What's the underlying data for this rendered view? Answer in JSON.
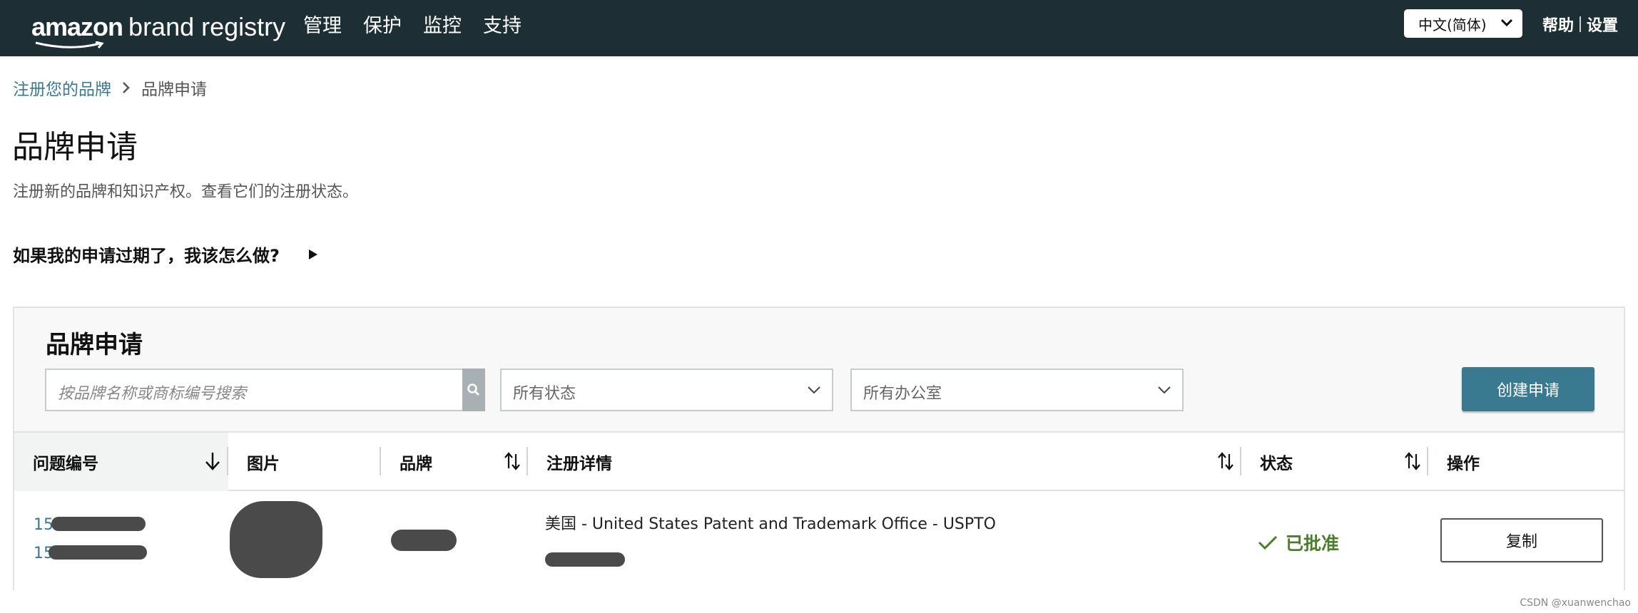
{
  "header": {
    "logo_amazon": "amazon",
    "logo_rest": "brand registry",
    "nav": [
      "管理",
      "保护",
      "监控",
      "支持"
    ],
    "language": "中文(简体)",
    "help": "帮助",
    "settings": "设置"
  },
  "breadcrumb": {
    "parent": "注册您的品牌",
    "current": "品牌申请"
  },
  "page": {
    "title": "品牌申请",
    "subtitle": "注册新的品牌和知识产权。查看它们的注册状态。",
    "faq": "如果我的申请过期了，我该怎么做?"
  },
  "panel": {
    "title": "品牌申请",
    "search_placeholder": "按品牌名称或商标编号搜索",
    "status_filter": "所有状态",
    "office_filter": "所有办公室",
    "create_button": "创建申请"
  },
  "table": {
    "columns": [
      "问题编号",
      "图片",
      "品牌",
      "注册详情",
      "状态",
      "操作"
    ],
    "rows": [
      {
        "id_1": "15",
        "id_2": "15",
        "registration": "美国 - United States Patent and Trademark Office - USPTO",
        "status": "已批准",
        "action": "复制"
      }
    ]
  },
  "watermark": "CSDN @xuanwenchao",
  "colors": {
    "topbar": "#1d2f34",
    "accent": "#3a7a91",
    "approved": "#4b7f2a"
  }
}
